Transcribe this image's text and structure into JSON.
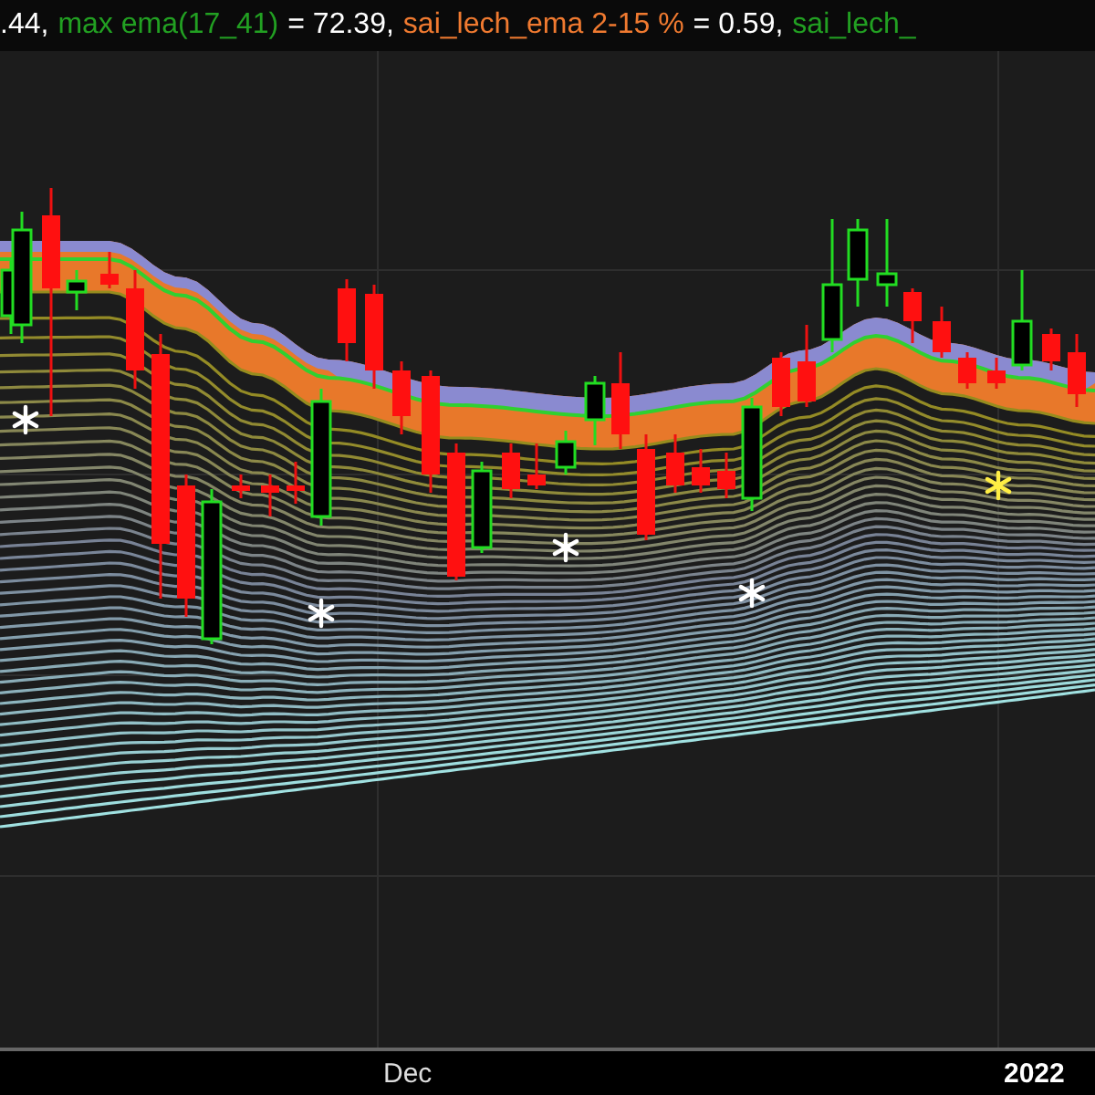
{
  "legend": [
    {
      "text": ".44,",
      "color": "#ffffff"
    },
    {
      "text": "max ema(17_41)",
      "color": "#22a022"
    },
    {
      "text": "= 72.39,",
      "color": "#ffffff"
    },
    {
      "text": "sai_lech_ema 2-15 %",
      "color": "#f07a30"
    },
    {
      "text": "= 0.59,",
      "color": "#ffffff"
    },
    {
      "text": "sai_lech_",
      "color": "#22a022"
    }
  ],
  "x_axis": {
    "labels": [
      "Dec",
      "2022"
    ]
  }
}
